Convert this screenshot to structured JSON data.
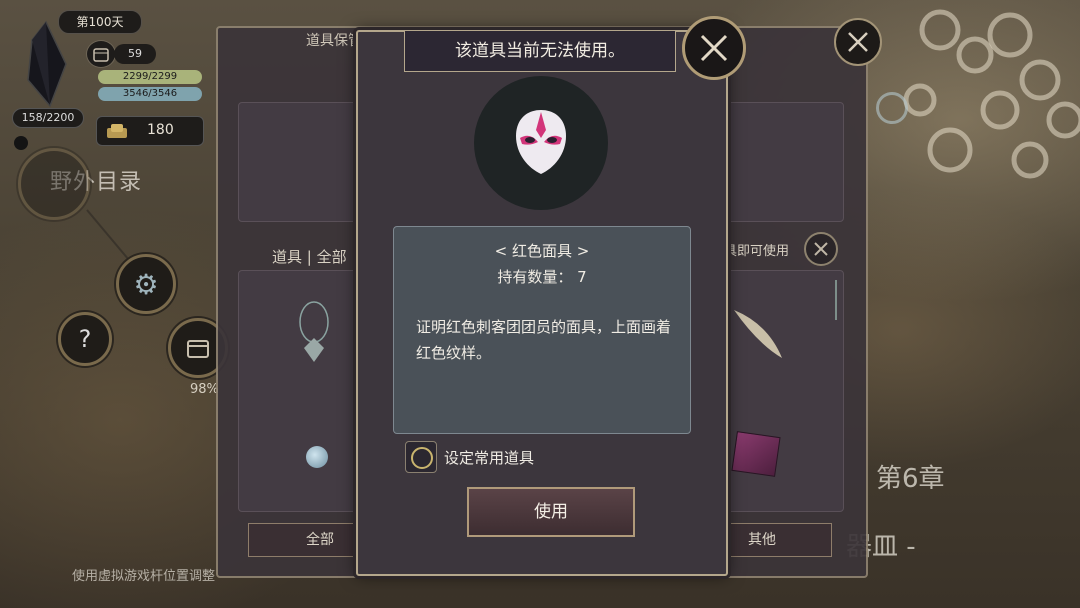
{
  "hud": {
    "day": "第100天",
    "calendar_count": "59",
    "hp": "2299/2299",
    "mp": "3546/3546",
    "crystal_value": "158/2200",
    "gold": "180",
    "wild_catalog": "野外目录",
    "progress_percent": "98%"
  },
  "back_panel": {
    "title": "道具保管箱",
    "tab_label": "道具 | 全部",
    "right_hint": "具即可使用",
    "filter_all": "全部",
    "filter_other": "其他"
  },
  "background": {
    "chapter": "第6章",
    "chapter_subtitle": "器皿 -",
    "hint": "使用虚拟游戏杆位置调整"
  },
  "modal": {
    "title": "该道具当前无法使用。",
    "item_name": "< 红色面具 >",
    "count_label": "持有数量：  7",
    "description": "证明红色刺客团团员的面具，上面画着红色纹样。",
    "checkbox_label": "设定常用道具",
    "use_button": "使用"
  },
  "icons": {
    "close": "close-icon",
    "mask": "red-mask-icon",
    "calendar": "calendar-icon",
    "gold": "gold-icon",
    "gear": "gear-icon",
    "question": "question-icon"
  }
}
